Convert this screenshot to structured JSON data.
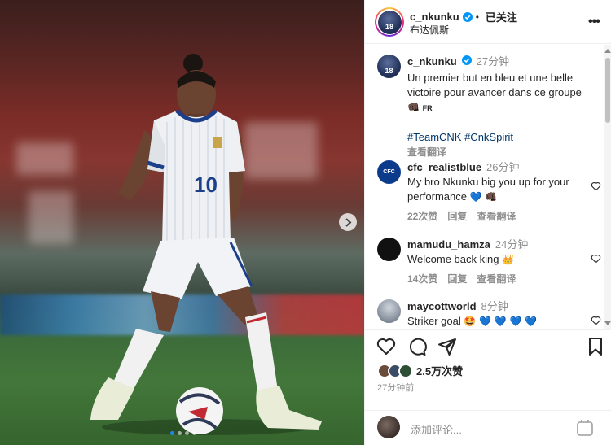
{
  "post": {
    "author": "c_nkunku",
    "follow_status": "已关注",
    "location": "布达佩斯",
    "more_label": "•••"
  },
  "caption": {
    "username": "c_nkunku",
    "time": "27分钟",
    "text": "Un premier but en bleu et une belle victoire pour avancer dans ce groupe",
    "emoji": "👊🏿",
    "flag": "FR",
    "tags": "#TeamCNK #CnkSpirit",
    "translate": "查看翻译"
  },
  "comments": [
    {
      "username": "cfc_realistblue",
      "time": "26分钟",
      "text": "My bro Nkunku big you up for your performance",
      "emojis": "💙 👊🏿",
      "likes": "22次赞",
      "reply": "回复",
      "translate": "查看翻译",
      "avatar_text": "CFC"
    },
    {
      "username": "mamudu_hamza",
      "time": "24分钟",
      "text": "Welcome back king",
      "emojis": "👑",
      "likes": "14次赞",
      "reply": "回复",
      "translate": "查看翻译"
    },
    {
      "username": "maycottworld",
      "time": "8分钟",
      "text": "Striker goal",
      "emojis": "🤩 💙 💙 💙 💙"
    }
  ],
  "footer": {
    "likes": "2.5万次赞",
    "timestamp": "27分钟前",
    "add_comment_placeholder": "添加评论...",
    "player_number": "10"
  },
  "colors": {
    "verified_blue": "#0095f6",
    "link_blue": "#00376b",
    "muted_gray": "#8e8e8e",
    "carousel_active_dot": "#1e88e5"
  },
  "icons": [
    "verified-badge-icon",
    "more-icon",
    "heart-icon",
    "comment-icon",
    "share-icon",
    "bookmark-icon",
    "chevron-right-icon",
    "gif-icon"
  ]
}
